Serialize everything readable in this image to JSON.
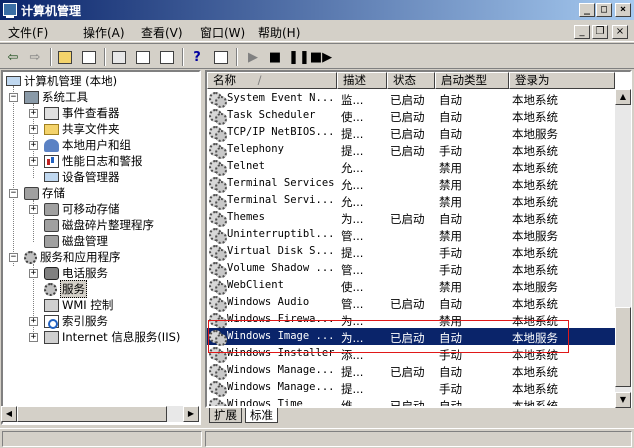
{
  "window": {
    "title": "计算机管理",
    "caption_buttons": [
      "_",
      "□",
      "×"
    ]
  },
  "menubar": {
    "items": [
      "文件(F)",
      "操作(A)",
      "查看(V)",
      "窗口(W)",
      "帮助(H)"
    ],
    "mdi_buttons": [
      "_",
      "❐",
      "×"
    ]
  },
  "toolbar": {
    "buttons": [
      "back-icon",
      "forward-icon",
      "up-folder-icon",
      "show-tree-icon",
      "properties-icon",
      "refresh-icon",
      "export-icon",
      "help-icon",
      "console-icon",
      "play-icon",
      "stop-icon",
      "pause-icon",
      "restart-icon"
    ]
  },
  "tree": {
    "root": "计算机管理 (本地)",
    "system_tools": "系统工具",
    "event_viewer": "事件查看器",
    "shared_folders": "共享文件夹",
    "local_users": "本地用户和组",
    "perf_logs": "性能日志和警报",
    "device_manager": "设备管理器",
    "storage": "存储",
    "removable_storage": "可移动存储",
    "defrag": "磁盘碎片整理程序",
    "disk_management": "磁盘管理",
    "services_apps": "服务和应用程序",
    "telephony": "电话服务",
    "services": "服务",
    "wmi_control": "WMI 控制",
    "indexing": "索引服务",
    "iis": "Internet 信息服务(IIS)"
  },
  "columns": {
    "name": "名称",
    "sort_indicator": "/",
    "description": "描述",
    "status": "状态",
    "startup_type": "启动类型",
    "log_on_as": "登录为"
  },
  "services": [
    {
      "name": "System Event N...",
      "description": "监...",
      "status": "已启动",
      "startup": "自动",
      "logon": "本地系统"
    },
    {
      "name": "Task Scheduler",
      "description": "使...",
      "status": "已启动",
      "startup": "自动",
      "logon": "本地系统"
    },
    {
      "name": "TCP/IP NetBIOS...",
      "description": "提...",
      "status": "已启动",
      "startup": "自动",
      "logon": "本地服务"
    },
    {
      "name": "Telephony",
      "description": "提...",
      "status": "已启动",
      "startup": "手动",
      "logon": "本地系统"
    },
    {
      "name": "Telnet",
      "description": "允...",
      "status": "",
      "startup": "禁用",
      "logon": "本地系统"
    },
    {
      "name": "Terminal Services",
      "description": "允...",
      "status": "",
      "startup": "禁用",
      "logon": "本地系统"
    },
    {
      "name": "Terminal Servi...",
      "description": "允...",
      "status": "",
      "startup": "禁用",
      "logon": "本地系统"
    },
    {
      "name": "Themes",
      "description": "为...",
      "status": "已启动",
      "startup": "自动",
      "logon": "本地系统"
    },
    {
      "name": "Uninterruptibl...",
      "description": "管...",
      "status": "",
      "startup": "禁用",
      "logon": "本地服务"
    },
    {
      "name": "Virtual Disk S...",
      "description": "提...",
      "status": "",
      "startup": "手动",
      "logon": "本地系统"
    },
    {
      "name": "Volume Shadow ...",
      "description": "管...",
      "status": "",
      "startup": "手动",
      "logon": "本地系统"
    },
    {
      "name": "WebClient",
      "description": "使...",
      "status": "",
      "startup": "禁用",
      "logon": "本地服务"
    },
    {
      "name": "Windows Audio",
      "description": "管...",
      "status": "已启动",
      "startup": "自动",
      "logon": "本地系统"
    },
    {
      "name": "Windows Firewa...",
      "description": "为...",
      "status": "",
      "startup": "禁用",
      "logon": "本地系统"
    },
    {
      "name": "Windows Image ...",
      "description": "为...",
      "status": "已启动",
      "startup": "自动",
      "logon": "本地服务"
    },
    {
      "name": "Windows Installer",
      "description": "添...",
      "status": "",
      "startup": "手动",
      "logon": "本地系统"
    },
    {
      "name": "Windows Manage...",
      "description": "提...",
      "status": "已启动",
      "startup": "自动",
      "logon": "本地系统"
    },
    {
      "name": "Windows Manage...",
      "description": "提...",
      "status": "",
      "startup": "手动",
      "logon": "本地系统"
    },
    {
      "name": "Windows Time",
      "description": "维...",
      "status": "已启动",
      "startup": "自动",
      "logon": "本地系统"
    }
  ],
  "selected_row": 14,
  "tabs": [
    "扩展",
    "标准"
  ],
  "active_tab": 1,
  "colors": {
    "title_gradient_start": "#0a246a",
    "title_gradient_end": "#a6caf0",
    "selection": "#0a246a",
    "annotation_box": "#e01818",
    "face": "#d4d0c8"
  }
}
